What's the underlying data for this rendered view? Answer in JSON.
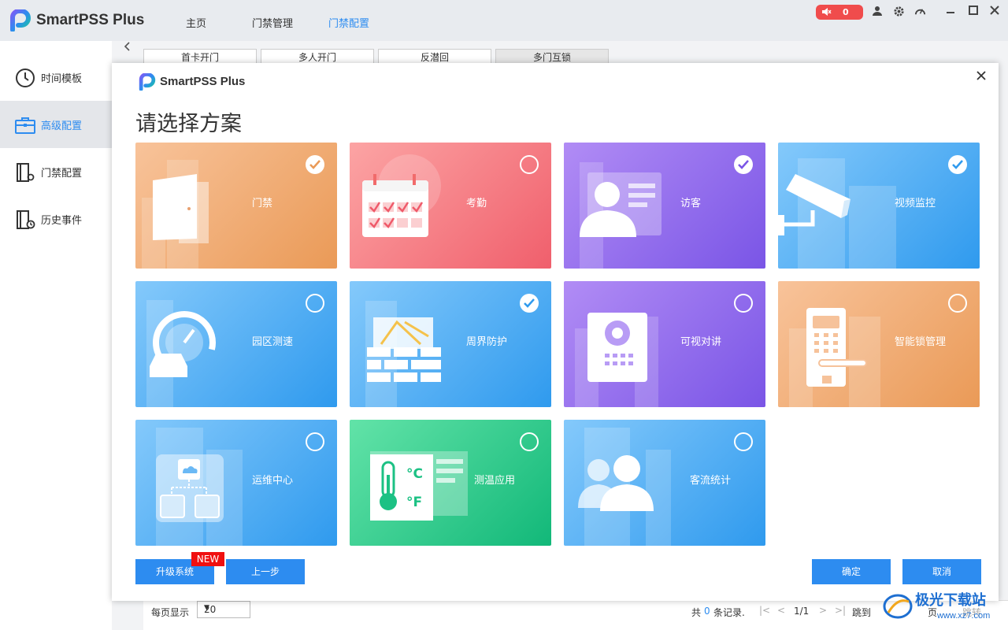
{
  "app": {
    "title": "SmartPSS Plus",
    "nav": [
      "主页",
      "门禁管理",
      "门禁配置"
    ],
    "active_nav": "门禁配置",
    "alarm_count": "0"
  },
  "sidebar": {
    "items": [
      {
        "label": "时间模板",
        "icon": "clock-icon"
      },
      {
        "label": "高级配置",
        "icon": "briefcase-icon"
      },
      {
        "label": "门禁配置",
        "icon": "door-config-icon"
      },
      {
        "label": "历史事件",
        "icon": "door-history-icon"
      }
    ],
    "active": "高级配置"
  },
  "background": {
    "tabs": [
      "首卡开门",
      "多人开门",
      "反潜回",
      "多门互锁"
    ],
    "footer": {
      "per_page_label": "每页显示",
      "per_page_value": "20",
      "total_prefix": "共",
      "total_count": "0",
      "total_suffix": "条记录.",
      "page": "1/1",
      "jump_label": "跳到",
      "page_unit": "页",
      "jump_button": "跳转"
    }
  },
  "modal": {
    "title": "SmartPSS Plus",
    "heading": "请选择方案",
    "cards": [
      {
        "label": "门禁",
        "checked": true,
        "theme": "orange",
        "icon": "door-icon"
      },
      {
        "label": "考勤",
        "checked": false,
        "theme": "pink",
        "icon": "calendar-icon"
      },
      {
        "label": "访客",
        "checked": true,
        "theme": "purple",
        "icon": "visitor-icon"
      },
      {
        "label": "视频监控",
        "checked": true,
        "theme": "blue",
        "icon": "camera-icon"
      },
      {
        "label": "园区测速",
        "checked": false,
        "theme": "blue",
        "icon": "speedometer-icon"
      },
      {
        "label": "周界防护",
        "checked": true,
        "theme": "blue",
        "icon": "wall-icon"
      },
      {
        "label": "可视对讲",
        "checked": false,
        "theme": "purple",
        "icon": "intercom-icon"
      },
      {
        "label": "智能锁管理",
        "checked": false,
        "theme": "orange",
        "icon": "smart-lock-icon"
      },
      {
        "label": "运维中心",
        "checked": false,
        "theme": "blue",
        "icon": "cloud-network-icon"
      },
      {
        "label": "测温应用",
        "checked": false,
        "theme": "green",
        "icon": "thermometer-icon"
      },
      {
        "label": "客流统计",
        "checked": false,
        "theme": "blue",
        "icon": "people-icon"
      }
    ],
    "buttons": {
      "upgrade": "升级系统",
      "new_badge": "NEW",
      "prev": "上一步",
      "confirm": "确定",
      "cancel": "取消"
    }
  },
  "watermark": {
    "text": "极光下载站",
    "url": "www.xz7.com"
  }
}
